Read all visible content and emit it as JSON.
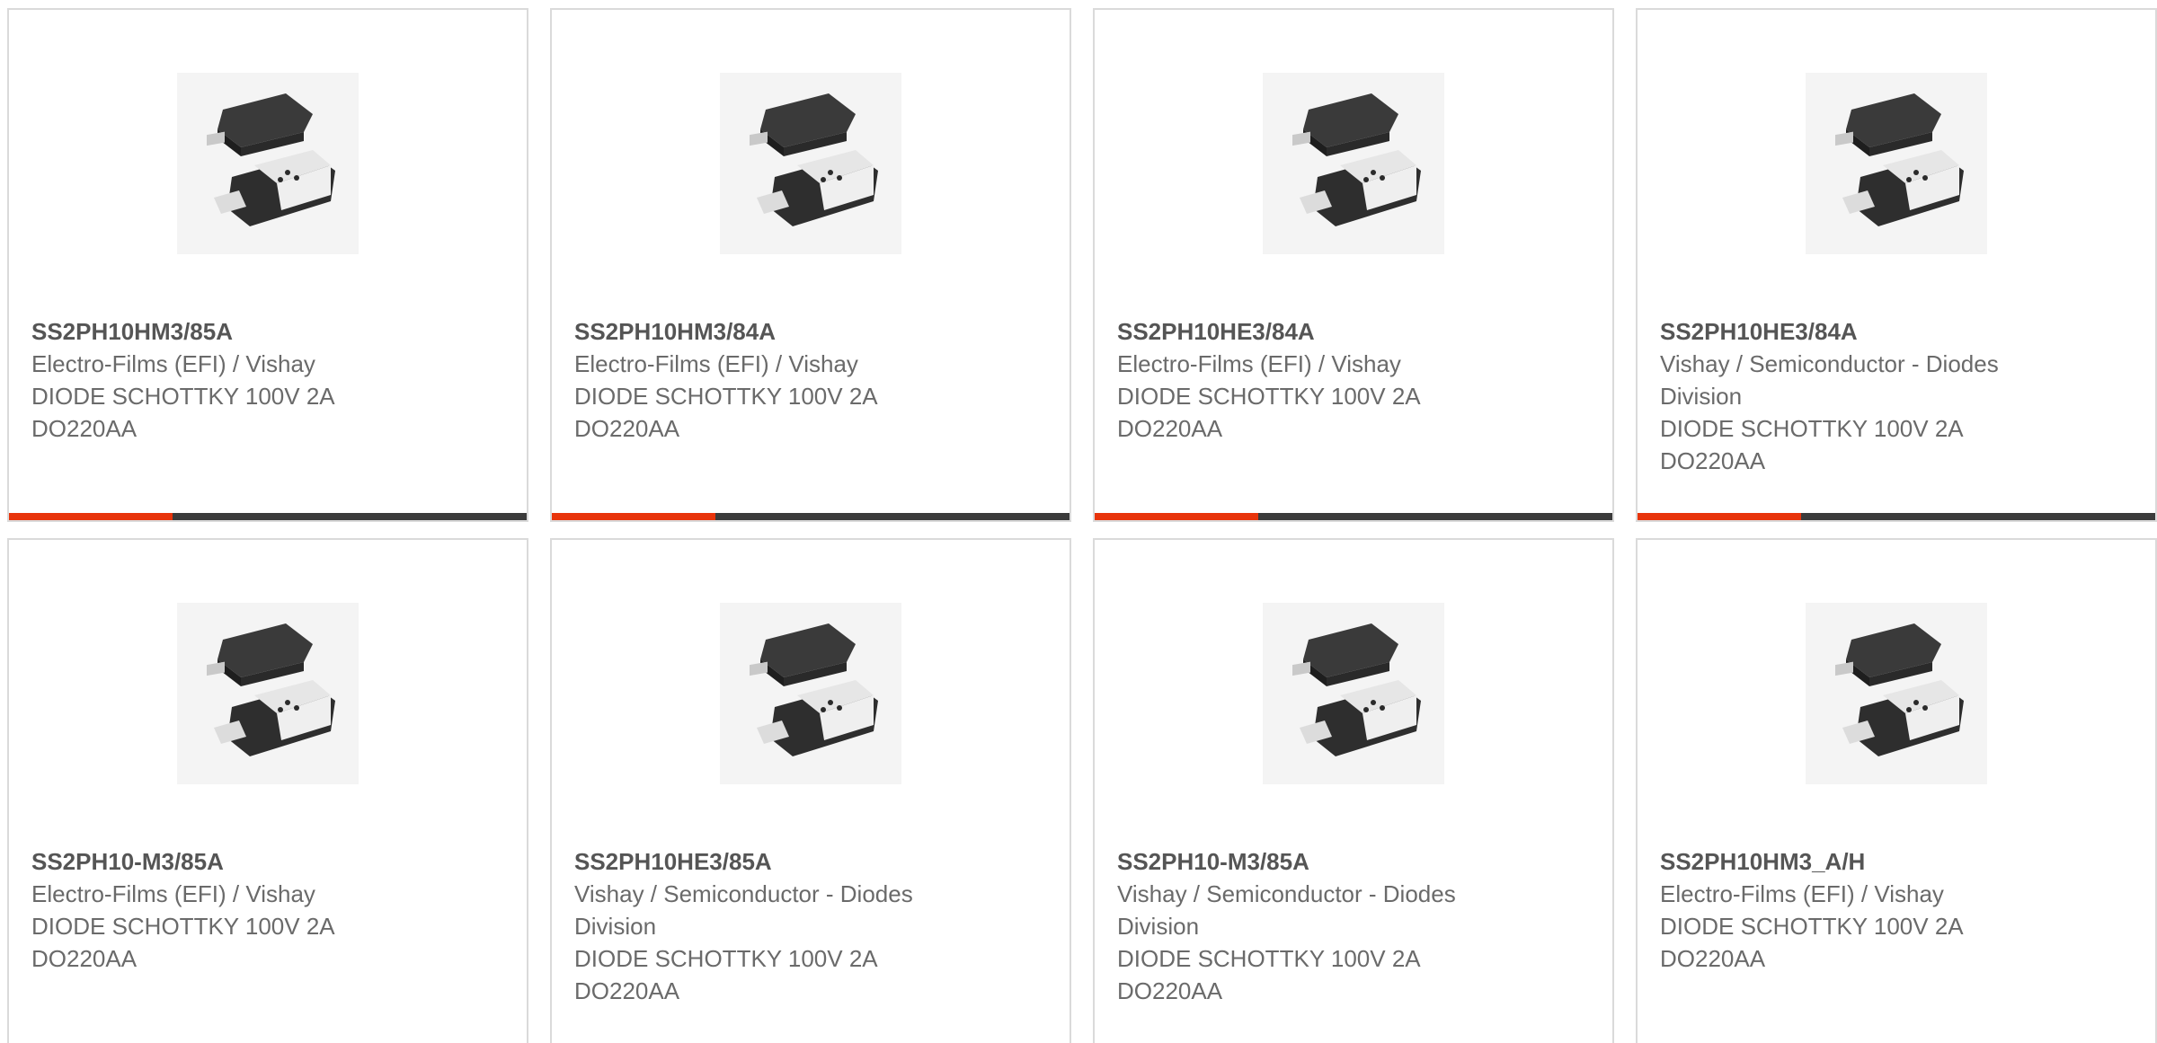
{
  "accent_color": "#e8340b",
  "bar_color": "#3b3b3b",
  "products": [
    {
      "part": "SS2PH10HM3/85A",
      "maker": "Electro-Films (EFI) / Vishay",
      "desc1": "DIODE SCHOTTKY 100V 2A",
      "desc2": "DO220AA",
      "image": "diode-package-icon"
    },
    {
      "part": "SS2PH10HM3/84A",
      "maker": "Electro-Films (EFI) / Vishay",
      "desc1": "DIODE SCHOTTKY 100V 2A",
      "desc2": "DO220AA",
      "image": "diode-package-icon"
    },
    {
      "part": "SS2PH10HE3/84A",
      "maker": "Electro-Films (EFI) / Vishay",
      "desc1": "DIODE SCHOTTKY 100V 2A",
      "desc2": "DO220AA",
      "image": "diode-package-icon"
    },
    {
      "part": "SS2PH10HE3/84A",
      "maker": "Vishay / Semiconductor - Diodes Division",
      "desc1": "DIODE SCHOTTKY 100V 2A",
      "desc2": "DO220AA",
      "image": "diode-package-icon"
    },
    {
      "part": "SS2PH10-M3/85A",
      "maker": "Electro-Films (EFI) / Vishay",
      "desc1": "DIODE SCHOTTKY 100V 2A",
      "desc2": "DO220AA",
      "image": "diode-package-icon"
    },
    {
      "part": "SS2PH10HE3/85A",
      "maker": "Vishay / Semiconductor - Diodes Division",
      "desc1": "DIODE SCHOTTKY 100V 2A",
      "desc2": "DO220AA",
      "image": "diode-package-icon"
    },
    {
      "part": "SS2PH10-M3/85A",
      "maker": "Vishay / Semiconductor - Diodes Division",
      "desc1": "DIODE SCHOTTKY 100V 2A",
      "desc2": "DO220AA",
      "image": "diode-package-icon"
    },
    {
      "part": "SS2PH10HM3_A/H",
      "maker": "Electro-Films (EFI) / Vishay",
      "desc1": "DIODE SCHOTTKY 100V 2A",
      "desc2": "DO220AA",
      "image": "diode-package-icon"
    }
  ]
}
